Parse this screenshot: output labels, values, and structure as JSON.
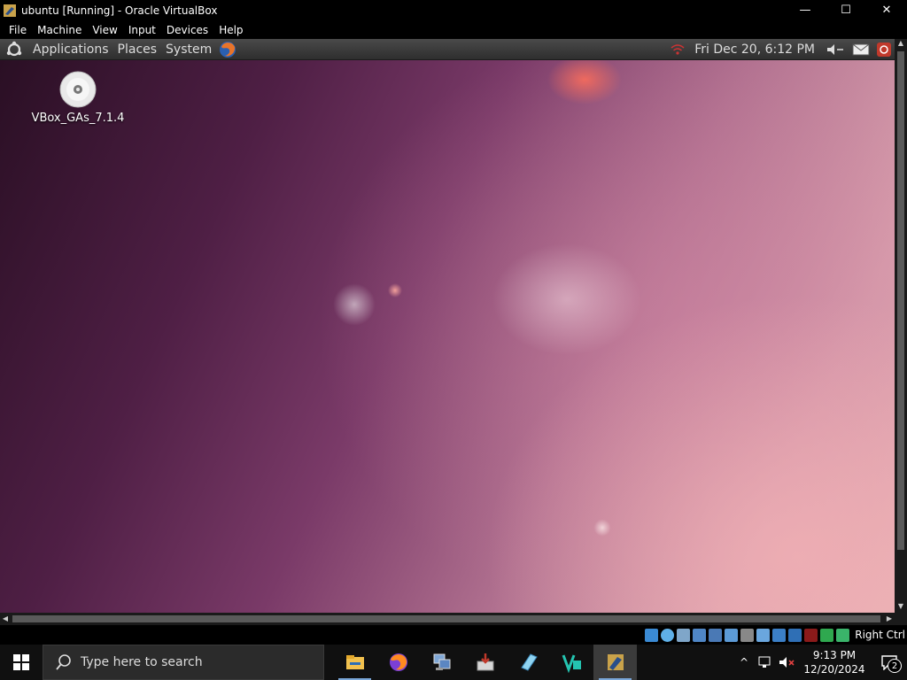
{
  "window": {
    "title": "ubuntu [Running] - Oracle VirtualBox"
  },
  "window_controls": {
    "minimize": "—",
    "maximize": "☐",
    "close": "✕"
  },
  "menubar": {
    "items": [
      "File",
      "Machine",
      "View",
      "Input",
      "Devices",
      "Help"
    ]
  },
  "guest_panel": {
    "menus": [
      "Applications",
      "Places",
      "System"
    ],
    "clock": "Fri Dec 20,  6:12 PM"
  },
  "desktop": {
    "icons": [
      {
        "label": "VBox_GAs_7.1.4",
        "icon": "cd-disc-icon"
      }
    ]
  },
  "statusbar": {
    "host_key": "Right Ctrl"
  },
  "taskbar": {
    "search_placeholder": "Type here to search",
    "apps": [
      "file-explorer-icon",
      "firefox-icon",
      "network-setup-icon",
      "installer-icon",
      "notepad-icon",
      "vs-icon",
      "virtualbox-icon"
    ],
    "time": "9:13 PM",
    "date": "12/20/2024",
    "notification_count": "2"
  }
}
